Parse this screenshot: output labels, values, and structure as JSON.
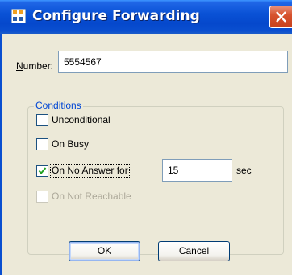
{
  "window": {
    "title": "Configure Forwarding",
    "app_icon": "phone-config-icon",
    "close_icon": "close-x-icon"
  },
  "number": {
    "label_accel": "N",
    "label_rest": "umber:",
    "value": "5554567"
  },
  "conditions": {
    "title": "Conditions",
    "items": [
      {
        "label": "Unconditional",
        "checked": false,
        "enabled": true
      },
      {
        "label": "On Busy",
        "checked": false,
        "enabled": true
      },
      {
        "label": "On No Answer for",
        "checked": true,
        "enabled": true
      },
      {
        "label": "On Not Reachable",
        "checked": false,
        "enabled": false
      }
    ],
    "timeout_value": "15",
    "timeout_unit": "sec"
  },
  "buttons": {
    "ok": "OK",
    "cancel": "Cancel"
  },
  "colors": {
    "title_bar": "#0a52d6",
    "dialog_bg": "#ece9d8",
    "group_title": "#0046d5",
    "check_mark": "#21a121",
    "disabled_text": "#aca899"
  }
}
